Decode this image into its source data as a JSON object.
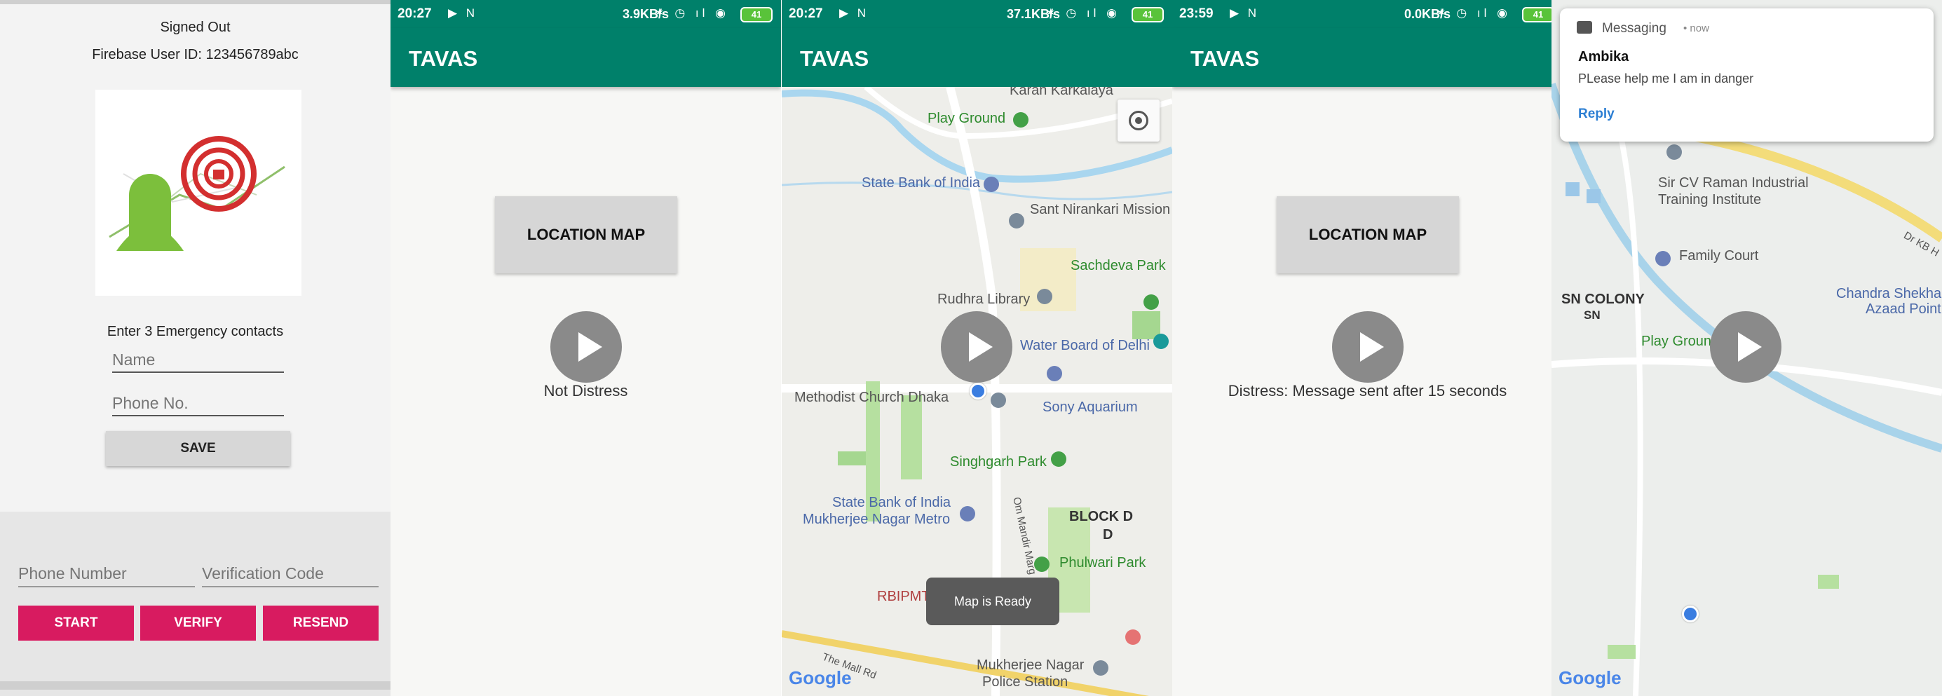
{
  "panel1": {
    "status_title": "Signed Out",
    "firebase_line": "Firebase User ID: 123456789abc",
    "contacts_label": "Enter 3 Emergency contacts",
    "name_placeholder": "Name",
    "phone_placeholder": "Phone No.",
    "save_label": "SAVE",
    "phone_number_placeholder": "Phone Number",
    "verification_placeholder": "Verification Code",
    "start_label": "START",
    "verify_label": "VERIFY",
    "resend_label": "RESEND",
    "accent_color": "#d81b60"
  },
  "panel2": {
    "time": "20:27",
    "net": "3.9KB/s",
    "battery": "41",
    "app_title": "TAVAS",
    "location_label": "LOCATION MAP",
    "status": "Not Distress"
  },
  "panel3": {
    "time": "20:27",
    "net": "37.1KB/s",
    "battery": "41",
    "app_title": "TAVAS",
    "toast": "Map is Ready",
    "labels": {
      "karan": "Karan Karkalaya",
      "playground": "Play Ground",
      "sbi1": "State Bank of India",
      "nirankari": "Sant Nirankari Mission",
      "sachdeva": "Sachdeva Park",
      "rudhra": "Rudhra Library",
      "water": "Water Board of Delhi",
      "methodist": "Methodist Church Dhaka",
      "sony": "Sony Aquarium",
      "singhgarh": "Singhgarh Park",
      "sbi2a": "State Bank of India",
      "sbi2b": "Mukherjee Nagar Metro",
      "omroad": "Om Mandir Marg",
      "blockd": "BLOCK D",
      "blockd2": "D",
      "phulwari": "Phulwari Park",
      "rbipmt": "RBIPMT",
      "mallrd": "The Mall Rd",
      "police1": "Mukherjee Nagar",
      "police2": "Police Station",
      "google": "Google"
    }
  },
  "panel4": {
    "time": "23:59",
    "net": "0.0KB/s",
    "battery": "41",
    "app_title": "TAVAS",
    "location_label": "LOCATION MAP",
    "status": "Distress: Message sent after 15 seconds"
  },
  "panel5": {
    "notif_app": "Messaging",
    "notif_when": "• now",
    "sender": "Ambika",
    "message": "PLease help me I am in danger",
    "reply_label": "Reply",
    "labels": {
      "cvraman1": "Sir CV Raman Industrial",
      "cvraman2": "Training Institute",
      "family": "Family Court",
      "sncolony": "SN COLONY",
      "sn": "SN",
      "playground": "Play Ground",
      "chandra1": "Chandra Shekhar",
      "chandra2": "Azaad Point",
      "drkb": "Dr KB H",
      "google": "Google"
    }
  }
}
